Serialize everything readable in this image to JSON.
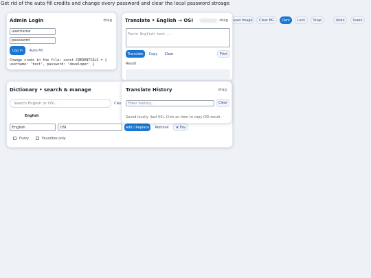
{
  "note": "Get rid of the auto fill credits and change every password and clear the local password stroage",
  "toolbar": {
    "buttons": [
      {
        "label": "Load Image",
        "active": false
      },
      {
        "label": "Clear BG",
        "active": false
      },
      {
        "label": "Dark",
        "active": true
      },
      {
        "label": "Lock",
        "active": false
      },
      {
        "label": "Snap",
        "active": false
      },
      {
        "label": "Undo",
        "active": false
      },
      {
        "label": "Users",
        "active": false
      }
    ]
  },
  "admin": {
    "title": "Admin Login",
    "drag": "drag",
    "username_value": "username",
    "password_value": "password",
    "login_label": "Log in",
    "autofill_label": "Auto-fill",
    "hint_line1": "Change creds in the file: const CREDENTIALS = {",
    "hint_line2": "username: 'test', password: 'developer' }"
  },
  "translate": {
    "title": "Translate • English → OSI",
    "drag": "drag",
    "placeholder": "Paste English text...",
    "translate_label": "Translate",
    "copy_label": "Copy",
    "clear_label": "Clear",
    "print_label": "Print",
    "result_label": "Result"
  },
  "dictionary": {
    "title": "Dictionary • search & manage",
    "search_placeholder": "Search English or OSI...",
    "clear_label": "Clear",
    "english_header": "English",
    "english_value": "English",
    "osi_value": "OSI",
    "add_label": "Add / Replace",
    "remove_label": "Remove",
    "fav_label": "★ Fav",
    "fuzzy_label": "Fuzzy",
    "favorites_label": "Favorites only"
  },
  "history": {
    "title": "Translate History",
    "drag": "drag",
    "filter_placeholder": "Filter history...",
    "clear_label": "Clear",
    "info": "Saved locally (last 50). Click an item to copy OSI result."
  },
  "colors": {
    "accent": "#1976d2",
    "background": "#eef1f6"
  }
}
